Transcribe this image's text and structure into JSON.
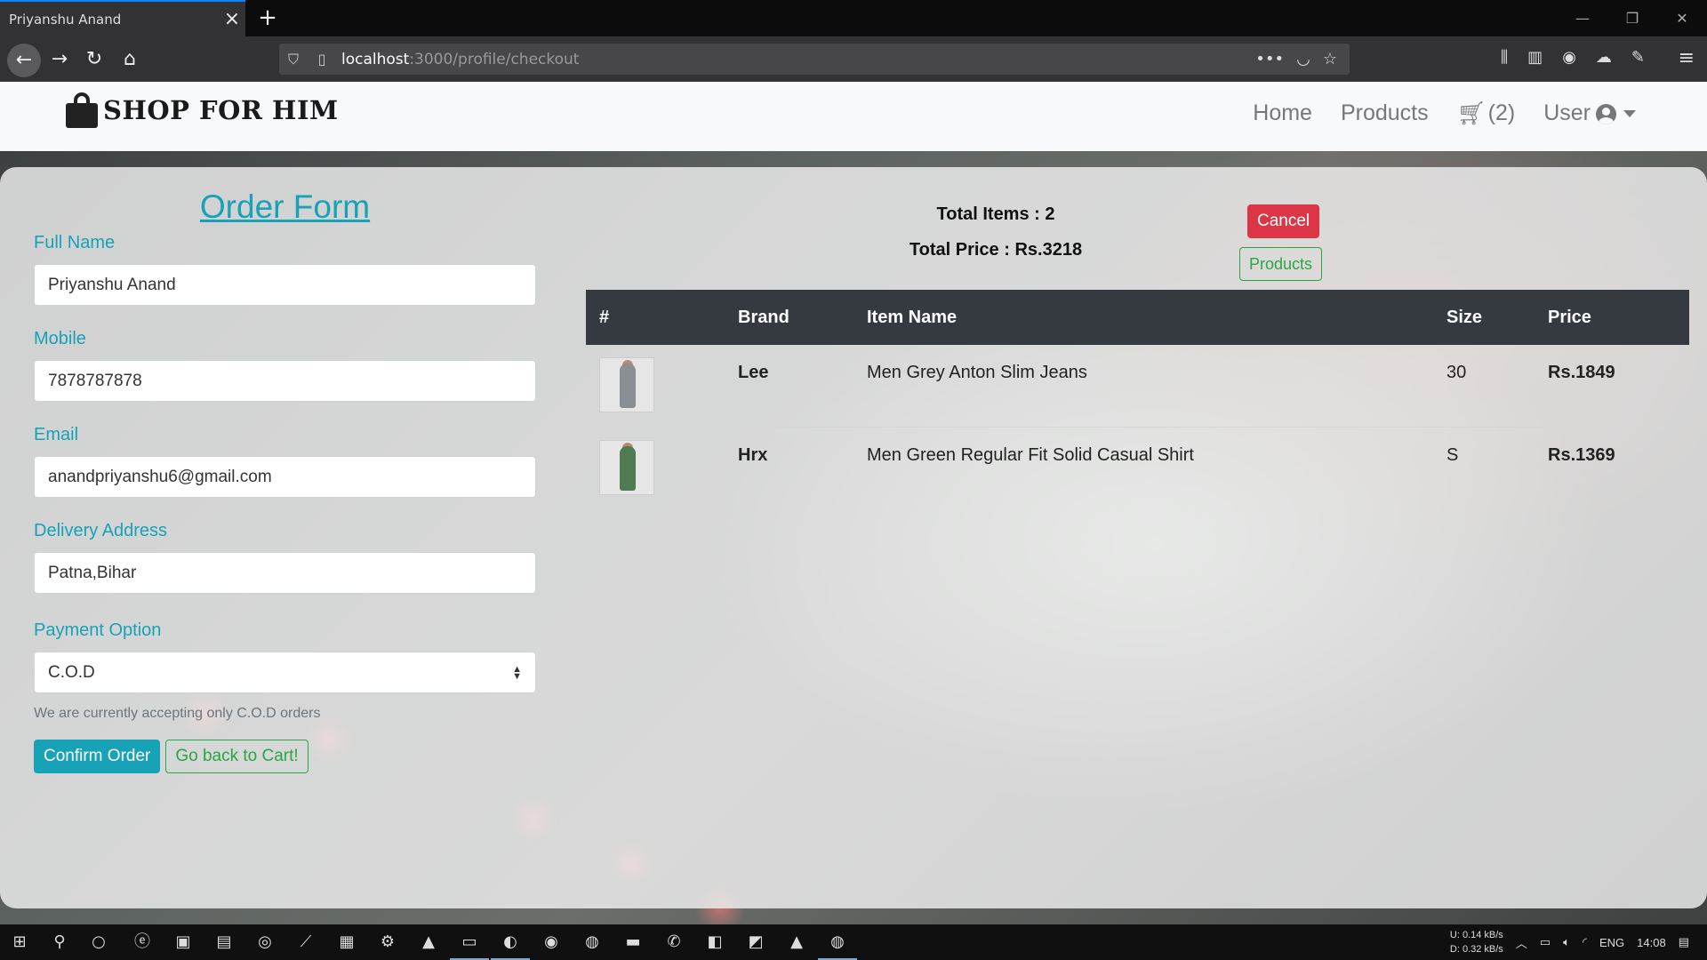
{
  "browser": {
    "tab_title": "Priyanshu Anand",
    "url_host": "localhost",
    "url_path": ":3000/profile/checkout"
  },
  "site": {
    "logo_text": "SHOP FOR HIM",
    "nav": {
      "home": "Home",
      "products": "Products",
      "cart_count": "(2)",
      "user": "User"
    }
  },
  "form": {
    "title": "Order Form",
    "full_name_label": "Full Name",
    "full_name_value": "Priyanshu Anand",
    "mobile_label": "Mobile",
    "mobile_value": "7878787878",
    "email_label": "Email",
    "email_value": "anandpriyanshu6@gmail.com",
    "address_label": "Delivery Address",
    "address_value": "Patna,Bihar",
    "payment_label": "Payment Option",
    "payment_value": "C.O.D",
    "payment_help": "We are currently accepting only C.O.D orders",
    "confirm_button": "Confirm Order",
    "back_button": "Go back to Cart!"
  },
  "summary": {
    "total_items": "Total Items : 2",
    "total_price": "Total Price : Rs.3218",
    "cancel_button": "Cancel",
    "products_button": "Products"
  },
  "table": {
    "headers": {
      "index": "#",
      "brand": "Brand",
      "item_name": "Item Name",
      "size": "Size",
      "price": "Price"
    },
    "rows": [
      {
        "brand": "Lee",
        "item_name": "Men Grey Anton Slim Jeans",
        "size": "30",
        "price": "Rs.1849",
        "thumb_color": "#8a8f96"
      },
      {
        "brand": "Hrx",
        "item_name": "Men Green Regular Fit Solid Casual Shirt",
        "size": "S",
        "price": "Rs.1369",
        "thumb_color": "#4f7a52"
      }
    ]
  },
  "taskbar": {
    "net_up": "0.14 kB/s",
    "net_down": "0.32 kB/s",
    "net_up_label": "U:",
    "net_down_label": "D:",
    "language": "ENG",
    "time": "14:08"
  },
  "colors": {
    "accent": "#17a2b8",
    "success": "#28a745",
    "danger": "#dc3545",
    "table_header": "#343a40"
  }
}
